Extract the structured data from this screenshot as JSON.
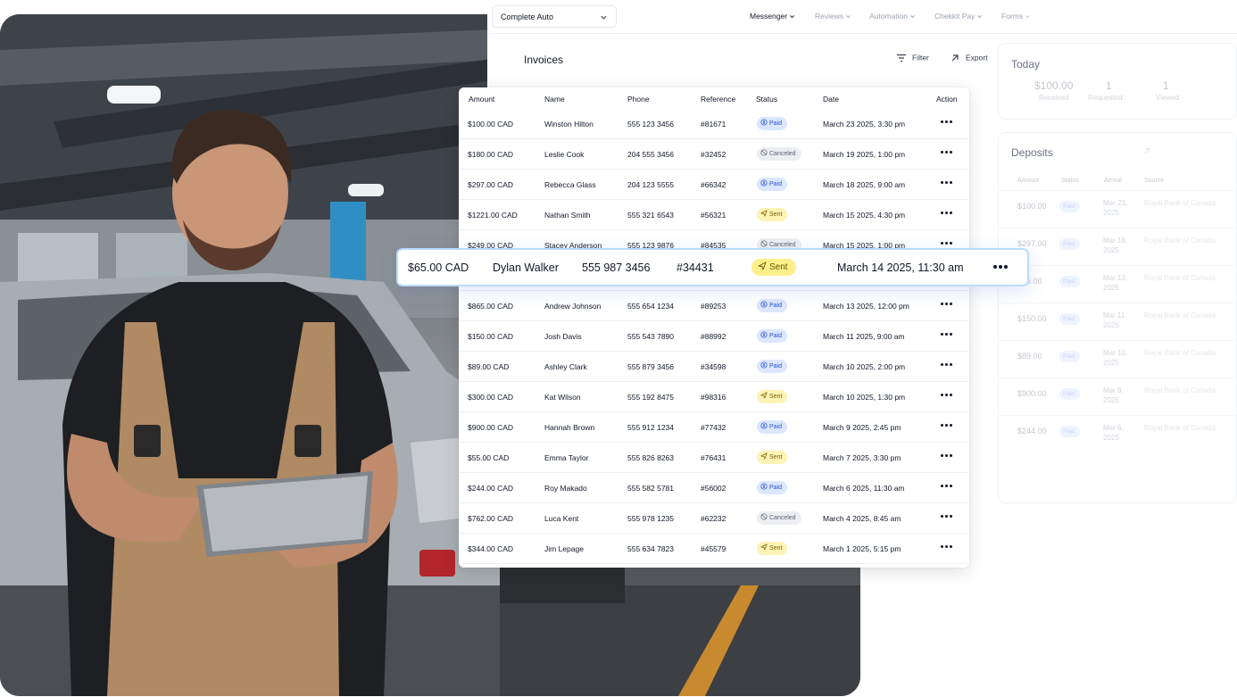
{
  "topbar": {
    "org": "Complete Auto",
    "nav": [
      "Messenger",
      "Reviews",
      "Automation",
      "Chekkit Pay",
      "Forms"
    ]
  },
  "invoices": {
    "title": "Invoices",
    "filter_label": "Filter",
    "export_label": "Export",
    "columns": [
      "Amount",
      "Name",
      "Phone",
      "Reference",
      "Status",
      "Date",
      "Action"
    ],
    "rows": [
      {
        "amount": "$100.00 CAD",
        "name": "Winston Hilton",
        "phone": "555 123 3456",
        "ref": "#81671",
        "status": "Paid",
        "date": "March 23 2025, 3:30 pm"
      },
      {
        "amount": "$180.00 CAD",
        "name": "Leslie Cook",
        "phone": "204 555 3456",
        "ref": "#32452",
        "status": "Canceled",
        "date": "March 19 2025, 1:00 pm"
      },
      {
        "amount": "$297.00 CAD",
        "name": "Rebecca Glass",
        "phone": "204 123 5555",
        "ref": "#66342",
        "status": "Paid",
        "date": "March 18 2025, 9:00 am"
      },
      {
        "amount": "$1221.00 CAD",
        "name": "Nathan Smith",
        "phone": "555 321 6543",
        "ref": "#56321",
        "status": "Sent",
        "date": "March 15 2025, 4:30 pm"
      },
      {
        "amount": "$249.00 CAD",
        "name": "Stacey Anderson",
        "phone": "555 123 9876",
        "ref": "#84535",
        "status": "Canceled",
        "date": "March 15 2025, 1:00 pm"
      },
      {
        "amount": "$65.00 CAD",
        "name": "Dylan Walker",
        "phone": "555 987 3456",
        "ref": "#34431",
        "status": "Sent",
        "date": "March 14 2025, 11:30 am"
      },
      {
        "amount": "$865.00 CAD",
        "name": "Andrew Johnson",
        "phone": "555 654 1234",
        "ref": "#89253",
        "status": "Paid",
        "date": "March 13 2025, 12:00 pm"
      },
      {
        "amount": "$150.00 CAD",
        "name": "Josh Davis",
        "phone": "555 543 7890",
        "ref": "#88992",
        "status": "Paid",
        "date": "March 11 2025, 9:00 am"
      },
      {
        "amount": "$89.00 CAD",
        "name": "Ashley Clark",
        "phone": "555 879 3456",
        "ref": "#34598",
        "status": "Paid",
        "date": "March 10 2025, 2:00 pm"
      },
      {
        "amount": "$300.00 CAD",
        "name": "Kat Wilson",
        "phone": "555 192 8475",
        "ref": "#98316",
        "status": "Sent",
        "date": "March 10 2025, 1:30 pm"
      },
      {
        "amount": "$900.00 CAD",
        "name": "Hannah Brown",
        "phone": "555 912 1234",
        "ref": "#77432",
        "status": "Paid",
        "date": "March 9 2025, 2:45 pm"
      },
      {
        "amount": "$55.00 CAD",
        "name": "Emma Taylor",
        "phone": "555 826 8263",
        "ref": "#76431",
        "status": "Sent",
        "date": "March 7 2025, 3:30 pm"
      },
      {
        "amount": "$244.00 CAD",
        "name": "Roy Makado",
        "phone": "555 582 5781",
        "ref": "#56002",
        "status": "Paid",
        "date": "March 6 2025, 11:30 am"
      },
      {
        "amount": "$762.00 CAD",
        "name": "Luca Kent",
        "phone": "555 978 1235",
        "ref": "#62232",
        "status": "Canceled",
        "date": "March 4 2025, 8:45 am"
      },
      {
        "amount": "$344.00 CAD",
        "name": "Jim Lepage",
        "phone": "555 634 7823",
        "ref": "#45579",
        "status": "Sent",
        "date": "March 1 2025, 5:15 pm"
      }
    ]
  },
  "highlight": {
    "amount": "$65.00 CAD",
    "name": "Dylan Walker",
    "phone": "555 987 3456",
    "ref": "#34431",
    "status": "Sent",
    "date": "March 14 2025, 11:30 am"
  },
  "today": {
    "title": "Today",
    "stats": [
      {
        "value": "$100.00",
        "label": "Received"
      },
      {
        "value": "1",
        "label": "Requested"
      },
      {
        "value": "1",
        "label": "Viewed"
      }
    ]
  },
  "deposits": {
    "title": "Deposits",
    "columns": [
      "Amount",
      "Status",
      "Arrival",
      "Source"
    ],
    "rows": [
      {
        "amount": "$100.00",
        "status": "Paid",
        "arrival": "Mar 23, 2025",
        "source": "Royal Bank of Canada"
      },
      {
        "amount": "$297.00",
        "status": "Paid",
        "arrival": "Mar 18, 2025",
        "source": "Royal Bank of Canada"
      },
      {
        "amount": "$65.00",
        "status": "Paid",
        "arrival": "Mar 13, 2025",
        "source": "Royal Bank of Canada"
      },
      {
        "amount": "$150.00",
        "status": "Paid",
        "arrival": "Mar 11, 2025",
        "source": "Royal Bank of Canada"
      },
      {
        "amount": "$89.00",
        "status": "Paid",
        "arrival": "Mar 10, 2025",
        "source": "Royal Bank of Canada"
      },
      {
        "amount": "$900.00",
        "status": "Paid",
        "arrival": "Mar 9, 2025",
        "source": "Royal Bank of Canada"
      },
      {
        "amount": "$244.00",
        "status": "Paid",
        "arrival": "Mar 6, 2025",
        "source": "Royal Bank of Canada"
      }
    ]
  },
  "colors": {
    "paid_bg": "#dbe7ff",
    "paid_fg": "#2b4fd6",
    "sent_bg": "#fdf3b4",
    "sent_fg": "#7a5d00",
    "canceled_bg": "#eceef1",
    "canceled_fg": "#5b6472",
    "highlight_border": "#b9dcff"
  }
}
